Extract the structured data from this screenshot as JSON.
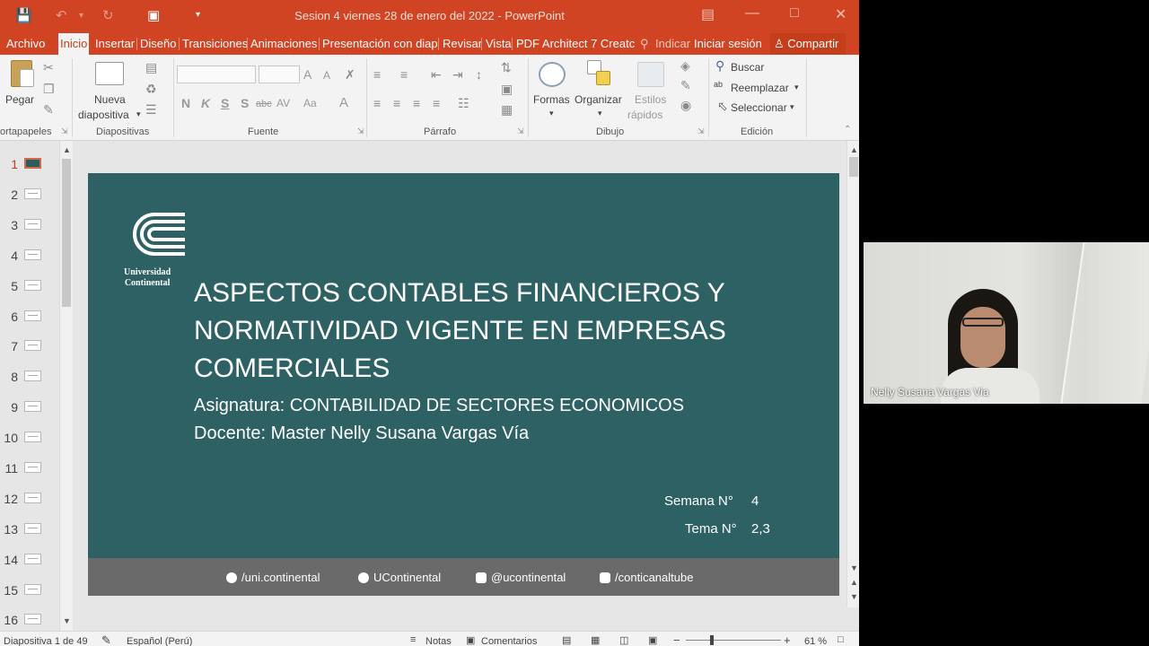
{
  "window": {
    "title": "Sesion 4 viernes 28 de enero del 2022 - PowerPoint",
    "colors": {
      "accent": "#d04423",
      "slide_bg": "#2e6164",
      "footer_bg": "#6a6a6a"
    }
  },
  "tabs": [
    "Archivo",
    "Inicio",
    "Insertar",
    "Diseño",
    "Transiciones",
    "Animaciones",
    "Presentación con diap",
    "Revisar",
    "Vista",
    "PDF Architect 7 Creatc",
    "Indicar",
    "Iniciar sesión",
    "Compartir"
  ],
  "ribbon": {
    "portapapeles": {
      "paste": "Pegar",
      "label": "ortapapeles"
    },
    "diapositivas": {
      "new_line1": "Nueva",
      "new_line2": "diapositiva",
      "label": "Diapositivas"
    },
    "fuente": {
      "bold": "N",
      "italic": "K",
      "underline": "S",
      "shadow": "S",
      "strike": "abc",
      "spacing": "AV",
      "case": "Aa",
      "color": "A",
      "grow": "A",
      "shrink": "A",
      "label": "Fuente"
    },
    "parrafo": {
      "label": "Párrafo"
    },
    "dibujo": {
      "shapes": "Formas",
      "arrange": "Organizar",
      "quick_line1": "Estilos",
      "quick_line2": "rápidos",
      "label": "Dibujo"
    },
    "edicion": {
      "find": "Buscar",
      "replace": "Reemplazar",
      "select": "Seleccionar",
      "label": "Edición"
    }
  },
  "thumbnails": [
    "1",
    "2",
    "3",
    "4",
    "5",
    "6",
    "7",
    "8",
    "9",
    "10",
    "11",
    "12",
    "13",
    "14",
    "15",
    "16"
  ],
  "slide": {
    "logo_line1": "Universidad",
    "logo_line2": "Continental",
    "title_line1": "ASPECTOS CONTABLES FINANCIEROS Y",
    "title_line2": "NORMATIVIDAD VIGENTE EN EMPRESAS",
    "title_line3": "COMERCIALES",
    "subject": "Asignatura: CONTABILIDAD DE SECTORES ECONOMICOS",
    "teacher": "Docente: Master Nelly Susana Vargas Vía",
    "week_label": "Semana N°",
    "week_value": "4",
    "topic_label": "Tema N°",
    "topic_value": "2,3",
    "socials": [
      "/uni.continental",
      "UContinental",
      "@ucontinental",
      "/conticanaltube"
    ]
  },
  "statusbar": {
    "slide_info": "Diapositiva 1 de 49",
    "language": "Español (Perú)",
    "notes": "Notas",
    "comments": "Comentarios",
    "zoom": "61 %"
  },
  "video": {
    "participant": "Nelly Susana Vargas Via"
  }
}
